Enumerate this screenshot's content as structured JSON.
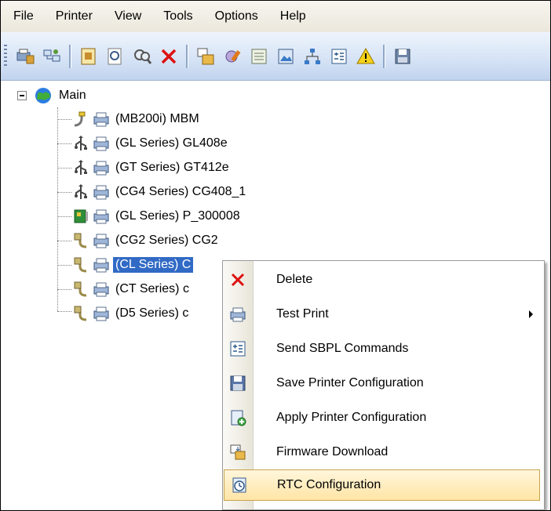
{
  "menubar": {
    "items": [
      "File",
      "Printer",
      "View",
      "Tools",
      "Options",
      "Help"
    ]
  },
  "toolbar": {
    "icons": [
      "printer-settings-icon",
      "network-icon",
      "config-icon",
      "search-icon",
      "find-icon",
      "delete-icon",
      "package-icon",
      "tools-icon",
      "list-icon",
      "picture-icon",
      "hierarchy-icon",
      "command-icon",
      "warning-icon",
      "save-icon"
    ]
  },
  "tree": {
    "root": "Main",
    "nodes": [
      {
        "label": "(MB200i) MBM",
        "connection": "serial-cable-icon"
      },
      {
        "label": "(GL Series) GL408e",
        "connection": "usb-icon"
      },
      {
        "label": "(GT Series) GT412e",
        "connection": "usb-icon"
      },
      {
        "label": "(CG4 Series) CG408_1",
        "connection": "usb-icon"
      },
      {
        "label": "(GL Series) P_300008",
        "connection": "network-card-icon"
      },
      {
        "label": "(CG2 Series) CG2",
        "connection": "parallel-port-icon"
      },
      {
        "label": "(CL Series) C",
        "connection": "parallel-port-icon",
        "selected": true
      },
      {
        "label": "(CT Series) c",
        "connection": "parallel-port-icon"
      },
      {
        "label": "(D5 Series) c",
        "connection": "parallel-port-icon"
      }
    ]
  },
  "context_menu": {
    "items": [
      {
        "label": "Delete",
        "icon": "delete-x-icon"
      },
      {
        "label": "Test Print",
        "icon": "printer-icon",
        "submenu": true
      },
      {
        "label": "Send SBPL Commands",
        "icon": "command-icon"
      },
      {
        "label": "Save Printer Configuration",
        "icon": "save-icon"
      },
      {
        "label": "Apply Printer Configuration",
        "icon": "apply-config-icon"
      },
      {
        "label": "Firmware Download",
        "icon": "firmware-icon"
      },
      {
        "label": "RTC Configuration",
        "icon": "clock-icon",
        "highlighted": true
      }
    ]
  },
  "colors": {
    "selection": "#316ac5",
    "menu_highlight": "#ffe5a5",
    "toolbar": "#d7e4f6"
  }
}
